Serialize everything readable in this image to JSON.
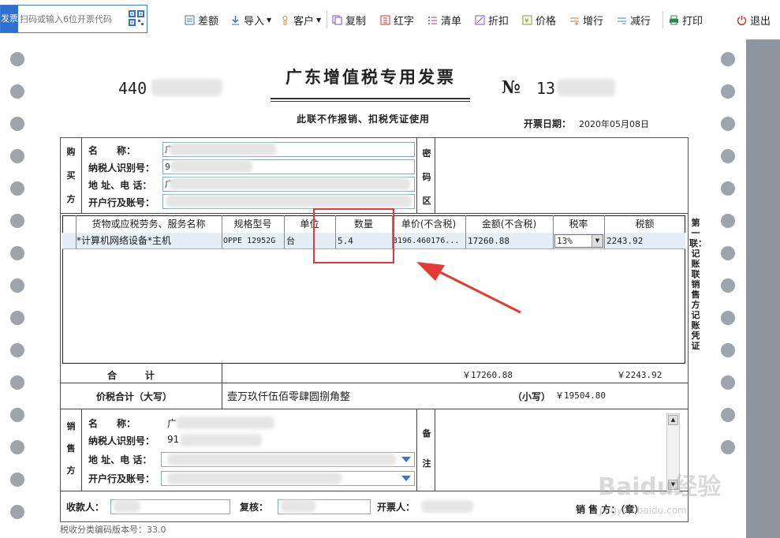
{
  "toolbar": {
    "scan_tag": "发票",
    "scan_placeholder": "扫码或输入6位开票代码",
    "items": [
      {
        "label": "差额"
      },
      {
        "label": "导入"
      },
      {
        "label": "客户"
      },
      {
        "label": "复制"
      },
      {
        "label": "红字"
      },
      {
        "label": "清单"
      },
      {
        "label": "折扣"
      },
      {
        "label": "价格"
      },
      {
        "label": "增行"
      },
      {
        "label": "减行"
      },
      {
        "label": "打印"
      },
      {
        "label": "退出"
      }
    ]
  },
  "invoice": {
    "title": "广东增值税专用发票",
    "code_visible": "440",
    "no_symbol": "№",
    "no_visible": "13",
    "subtitle": "此联不作报销、扣税凭证使用",
    "date_label": "开票日期：",
    "date_value": "2020年05月08日",
    "buyer": {
      "side_label": [
        "购",
        "买",
        "方"
      ],
      "name_label": "名　　称：",
      "name_value": "广",
      "taxid_label": "纳税人识别号：",
      "taxid_value": "9",
      "addr_label": "地 址、电 话：",
      "addr_value": "广",
      "bank_label": "开户行及账号：",
      "bank_value": ""
    },
    "cipher_label": [
      "密",
      "码",
      "区"
    ],
    "columns": [
      "货物或应税劳务、服务名称",
      "规格型号",
      "单位",
      "数量",
      "单价(不含税)",
      "金额(不含税)",
      "税率",
      "税额"
    ],
    "items": [
      {
        "name": "*计算机网络设备*主机",
        "spec": "OPPE 12952G",
        "unit": "台",
        "qty": "5.4",
        "price": "3196.460176...",
        "amount": "17260.88",
        "rate": "13%",
        "tax": "2243.92"
      }
    ],
    "total_label": "合　　　计",
    "total_amount": "￥17260.88",
    "total_tax": "￥2243.92",
    "grand_label": "价税合计（大写）",
    "grand_upper": "壹万玖仟伍佰零肆圆捌角整",
    "grand_lower_label": "（小写）",
    "grand_lower": "￥19504.80",
    "seller": {
      "side_label": [
        "销",
        "售",
        "方"
      ],
      "name_label": "名　　称：",
      "name_value": "广",
      "taxid_label": "纳税人识别号：",
      "taxid_value": "91",
      "addr_label": "地 址、电 话：",
      "addr_value": "",
      "bank_label": "开户行及账号：",
      "bank_value": ""
    },
    "remark_label": [
      "备",
      "注"
    ],
    "copy_label": "第一联：记账联 销售方记账凭证",
    "payee_label": "收款人：",
    "reviewer_label": "复核：",
    "drawer_label": "开票人：",
    "seal_label": "销 售 方：（章）",
    "version": "税收分类编码版本号：33.0"
  },
  "watermark": {
    "main": "Baidu经验",
    "sub": "jingyan.baidu.com"
  },
  "colors": {
    "accent": "#2f6fd0",
    "highlight": "#e53935",
    "row_bg": "#e6edf7"
  }
}
